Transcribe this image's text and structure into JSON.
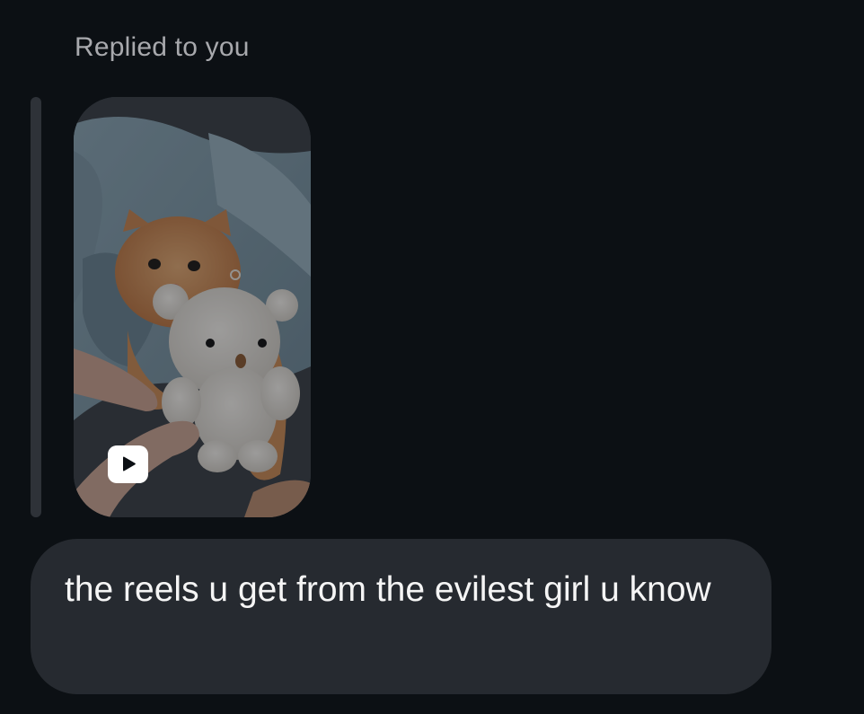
{
  "reply_header": {
    "label": "Replied to you"
  },
  "replied_media": {
    "type": "reel",
    "icon": "reel-play-icon"
  },
  "message": {
    "text": "the reels u get from the evilest girl u know"
  },
  "colors": {
    "background": "#0c1014",
    "bubble": "#262a30",
    "reply_bar": "#2e3238",
    "label_text": "#a8a9ad",
    "message_text": "#f5f5f5"
  }
}
